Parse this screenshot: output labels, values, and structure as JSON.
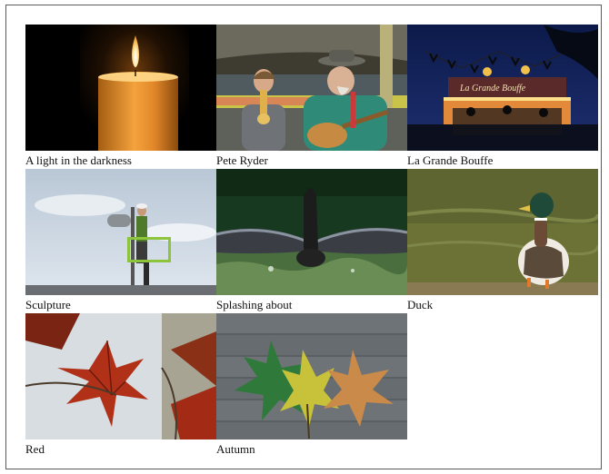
{
  "gallery": {
    "items": [
      {
        "caption": "A light in the darkness",
        "image": "candle-photo"
      },
      {
        "caption": "Pete Ryder",
        "image": "musicians-photo"
      },
      {
        "caption": "La Grande Bouffe",
        "image": "fairground-night-photo"
      },
      {
        "caption": "Sculpture",
        "image": "worker-on-lift-photo"
      },
      {
        "caption": "Splashing about",
        "image": "bird-wings-water-photo"
      },
      {
        "caption": "Duck",
        "image": "mallard-duck-photo"
      },
      {
        "caption": "Red",
        "image": "red-leaves-photo"
      },
      {
        "caption": "Autumn",
        "image": "autumn-leaves-bench-photo"
      }
    ]
  }
}
